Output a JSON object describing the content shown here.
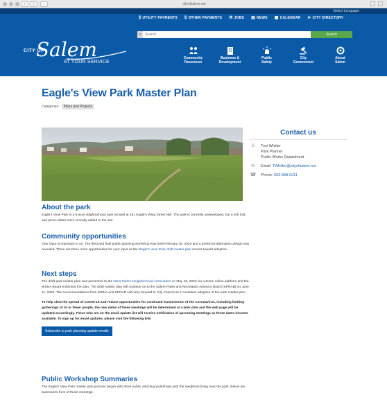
{
  "browser": {
    "url": "cityofsalem.net"
  },
  "header": {
    "translate": "Select Language",
    "utility": [
      {
        "icon": "$",
        "label": "UTILITY PAYMENTS"
      },
      {
        "icon": "$",
        "label": "OTHER PAYMENTS"
      },
      {
        "icon": "⚒",
        "label": "JOBS"
      },
      {
        "icon": "▤",
        "label": "NEWS"
      },
      {
        "icon": "▦",
        "label": "CALENDAR"
      },
      {
        "icon": "➤",
        "label": "CITY DIRECTORY"
      }
    ],
    "search_placeholder": "Search...",
    "search_button": "Search",
    "logo": {
      "city_of": "CITY OF",
      "name": "Salem",
      "tagline": "AT YOUR SERVICE"
    },
    "nav": [
      {
        "label1": "Community",
        "label2": "Resources"
      },
      {
        "label1": "Business &",
        "label2": "Development"
      },
      {
        "label1": "Public",
        "label2": "Safety"
      },
      {
        "label1": "City",
        "label2": "Government"
      },
      {
        "label1": "About",
        "label2": "Salem"
      }
    ]
  },
  "page": {
    "title": "Eagle's View Park Master Plan",
    "categories_label": "Categories:",
    "category": "Plans and Projects"
  },
  "contact": {
    "heading": "Contact us",
    "name": "Toni Whitler",
    "role": "Park Planner",
    "dept": "Public Works Department",
    "email_label": "Email:",
    "email": "TWhitler@cityofsalem.net",
    "phone_label": "Phone:",
    "phone": "503-588-6211"
  },
  "about": {
    "heading": "About the park",
    "text": "Eagle's View Park is a 5-acre neighborhood park located at 451 Eagle's Wing Street NW. The park is currently undeveloped, but a soft trail and picnic tables were recently added to the site."
  },
  "community": {
    "heading": "Community opportunities",
    "text": "Your input is important to us. The third and final public planning workshop was held February 26, 2020 and a preferred alternative design was revealed.  There are three more opportunities for your input as the",
    "link": "Eagle's View Park draft master plan",
    "text_end": "moves toward adoption."
  },
  "next": {
    "heading": "Next steps",
    "text_a": "The draft park master plan was presented to the",
    "link": "West Salem Neighborhood Association",
    "text_b": "on May 18, 2020 via a Zoom online platform and the WSNA Board endorsed the plan. The draft master plan will continue on to the Salem Parks and Recreation Advisory Board (SPRAB) on June 11, 2020. The recommendations from WSNA and SPRAB will carry forward to City Council as it considers adoption of the park master plan.",
    "notice": "To help slow the spread of COVID-19 and reduce opportunities for continued transmission of the Coronavirus, including limiting gatherings of 10 or fewer people, the new dates of these meetings will be determined at a later date and the web page will be updated accordingly. These who are on the email update list will receive notification of upcoming meetings as these dates become available. To sign up for email updates, please visit the following link:",
    "button": "Subscribe to park planning update emails"
  },
  "workshops": {
    "heading": "Public Workshop Summaries",
    "text": "The Eagle's View Park master plan process began with three public visioning workshops with the neighbors living near the park. Below are summaries from of those meetings."
  }
}
